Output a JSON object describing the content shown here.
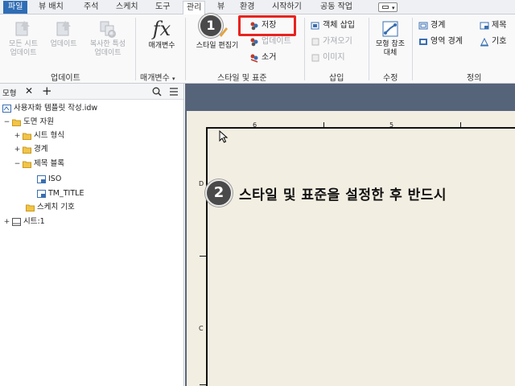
{
  "tabs": [
    "파일",
    "뷰 배치",
    "주석",
    "스케치",
    "도구",
    "관리",
    "뷰",
    "환경",
    "시작하기",
    "공동 작업"
  ],
  "ribbon": {
    "update_panel": {
      "label": "업데이트",
      "buttons": [
        {
          "line1": "모든 시트",
          "line2": "업데이트"
        },
        {
          "line1": "업데이트",
          "line2": ""
        },
        {
          "line1": "복사한 특성",
          "line2": "업데이트"
        }
      ]
    },
    "params_panel": {
      "label": "매개변수",
      "button": "매개변수",
      "icon": "fx"
    },
    "style_panel": {
      "label": "스타일 및 표준",
      "editor": "스타일 편집기",
      "save": "저장",
      "update": "업데이트",
      "purge": "소거"
    },
    "insert_panel": {
      "label": "삽입",
      "insert_object": "객체 삽입",
      "import": "가져오기",
      "image": "이미지"
    },
    "modify_panel": {
      "label": "수정",
      "line1": "모형 참조",
      "line2": "대체"
    },
    "define_panel": {
      "label": "정의",
      "border": "경계",
      "title": "제목",
      "zone_border": "영역 경계",
      "symbol": "기호"
    }
  },
  "browser": {
    "tab_label": "모형",
    "items": [
      "사용자화 템플릿 작성.idw",
      "도면 자원",
      "시트 형식",
      "경계",
      "제목 블록",
      "ISO",
      "TM_TITLE",
      "스케치 기호",
      "시트:1"
    ]
  },
  "sheet": {
    "col_labels": [
      "6",
      "5"
    ],
    "row_labels": [
      "D",
      "C"
    ]
  },
  "callouts": {
    "step1": "1",
    "step2": "2",
    "step2_text": "스타일 및 표준을 설정한 후 반드시"
  },
  "colors": {
    "highlight": "#e8231e",
    "file_tab": "#2f6db5",
    "canvas": "#56647a",
    "sheet": "#f3eee2"
  }
}
